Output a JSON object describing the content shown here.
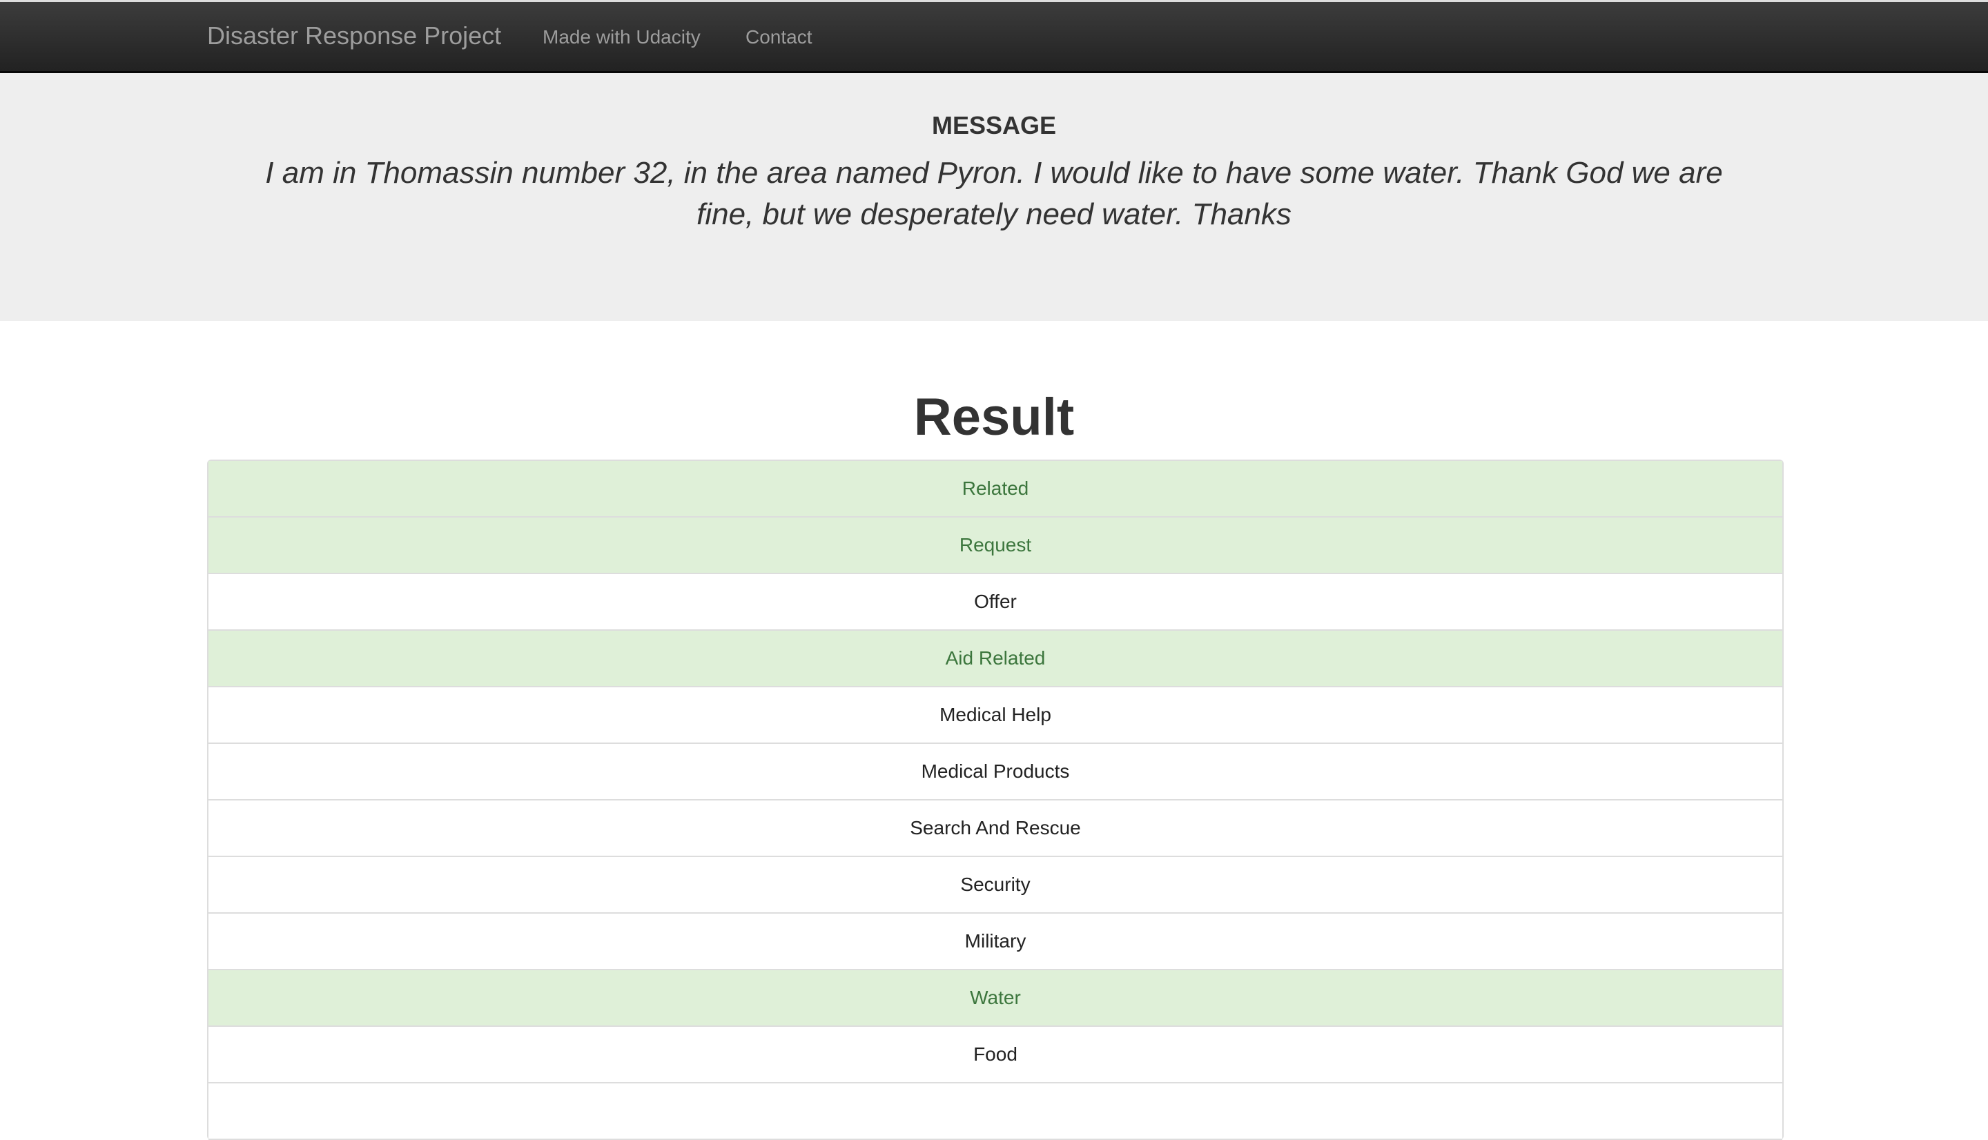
{
  "navbar": {
    "brand": "Disaster Response Project",
    "links": [
      "Made with Udacity",
      "Contact"
    ]
  },
  "message": {
    "heading": "MESSAGE",
    "text": "I am in Thomassin number 32, in the area named Pyron. I would like to have some water. Thank God we are fine, but we desperately need water. Thanks"
  },
  "result": {
    "heading": "Result",
    "categories": [
      {
        "label": "Related",
        "active": true
      },
      {
        "label": "Request",
        "active": true
      },
      {
        "label": "Offer",
        "active": false
      },
      {
        "label": "Aid Related",
        "active": true
      },
      {
        "label": "Medical Help",
        "active": false
      },
      {
        "label": "Medical Products",
        "active": false
      },
      {
        "label": "Search And Rescue",
        "active": false
      },
      {
        "label": "Security",
        "active": false
      },
      {
        "label": "Military",
        "active": false
      },
      {
        "label": "Water",
        "active": true
      },
      {
        "label": "Food",
        "active": false
      },
      {
        "label": "",
        "active": false
      }
    ]
  },
  "colors": {
    "active_bg": "#dff0d8",
    "active_text": "#3c763d"
  }
}
